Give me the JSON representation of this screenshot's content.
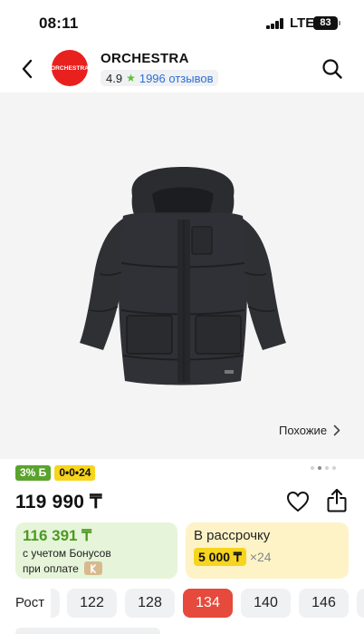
{
  "status_bar": {
    "time": "08:11",
    "network": "LTE",
    "battery": "83"
  },
  "header": {
    "logo_text": "ORCHESTRA",
    "store_name": "ORCHESTRA",
    "rating": "4.9",
    "reviews": "1996 отзывов"
  },
  "gallery": {
    "similar_label": "Похожие",
    "image_count": 4,
    "active_index": 1
  },
  "badges": {
    "bonus": "3% Б",
    "installment": "0•0•24"
  },
  "price": "119 990 ₸",
  "bonus_offer": {
    "price": "116 391 ₸",
    "note_line1": "с учетом Бонусов",
    "note_line2": "при оплате"
  },
  "installment_offer": {
    "title": "В рассрочку",
    "amount": "5 000 ₸",
    "months": "×24"
  },
  "sizes": {
    "label": "Рост",
    "options": [
      "122",
      "128",
      "134",
      "140",
      "146"
    ],
    "selected": "134"
  },
  "colors": {
    "accent_red": "#e64a3c",
    "bonus_green": "#5aa32c",
    "installment_yellow": "#f7d41d",
    "link_blue": "#2c6fd6"
  }
}
